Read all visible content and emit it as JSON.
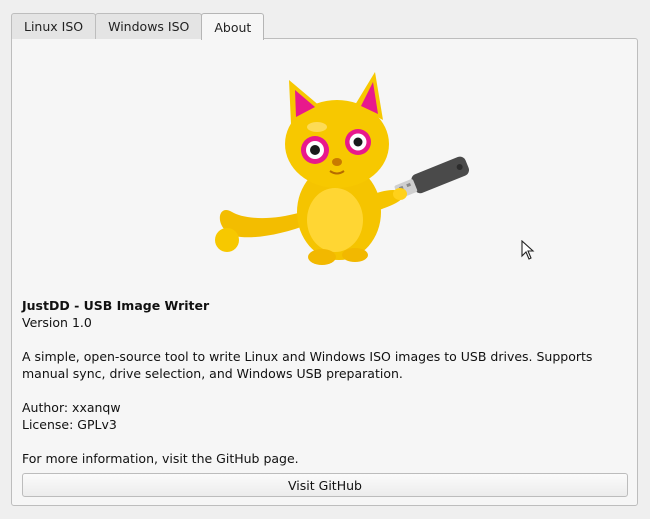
{
  "tabs": [
    {
      "label": "Linux ISO"
    },
    {
      "label": "Windows ISO"
    },
    {
      "label": "About",
      "active": true
    }
  ],
  "about": {
    "app_name": "JustDD - USB Image Writer",
    "version": "Version 1.0",
    "description": "A simple, open-source tool to write Linux and Windows ISO images to USB drives. Supports manual sync, drive selection, and Windows USB preparation.",
    "author": "Author: xxanqw",
    "license": "License: GPLv3",
    "more_info": "For more information, visit the GitHub page.",
    "github_button": "Visit GitHub"
  },
  "colors": {
    "cat_body": "#f5c400",
    "cat_accent": "#e8198c",
    "usb_body": "#4a4a4a",
    "usb_plug": "#d0d0d0"
  },
  "icons": {
    "mascot": "yellow-cat-holding-usb-icon",
    "cursor": "mouse-pointer-icon"
  }
}
